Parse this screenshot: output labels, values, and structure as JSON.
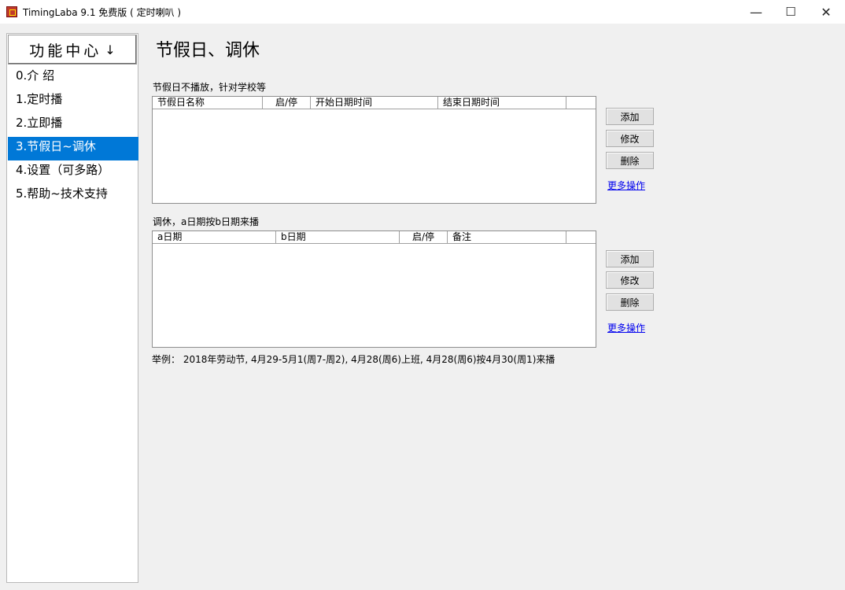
{
  "window": {
    "title": "TimingLaba 9.1 免费版 ( 定时喇叭 )",
    "minimize": "—",
    "maximize": "☐",
    "close": "✕"
  },
  "sidebar": {
    "header": "功能中心",
    "header_icon": "↓",
    "items": [
      {
        "label": "0.介 绍"
      },
      {
        "label": "1.定时播"
      },
      {
        "label": "2.立即播"
      },
      {
        "label": "3.节假日~调休"
      },
      {
        "label": "4.设置（可多路）"
      },
      {
        "label": "5.帮助~技术支持"
      }
    ]
  },
  "main": {
    "title": "节假日、调休",
    "holiday": {
      "label": "节假日不播放，针对学校等",
      "columns": [
        "节假日名称",
        "启/停",
        "开始日期时间",
        "结束日期时间"
      ],
      "add": "添加",
      "edit": "修改",
      "delete": "删除",
      "more": "更多操作"
    },
    "shift": {
      "label": "调休，a日期按b日期来播",
      "columns": [
        "a日期",
        "b日期",
        "启/停",
        "备注"
      ],
      "add": "添加",
      "edit": "修改",
      "delete": "删除",
      "more": "更多操作"
    },
    "example": "举例：  2018年劳动节, 4月29-5月1(周7-周2), 4月28(周6)上班, 4月28(周6)按4月30(周1)来播"
  }
}
